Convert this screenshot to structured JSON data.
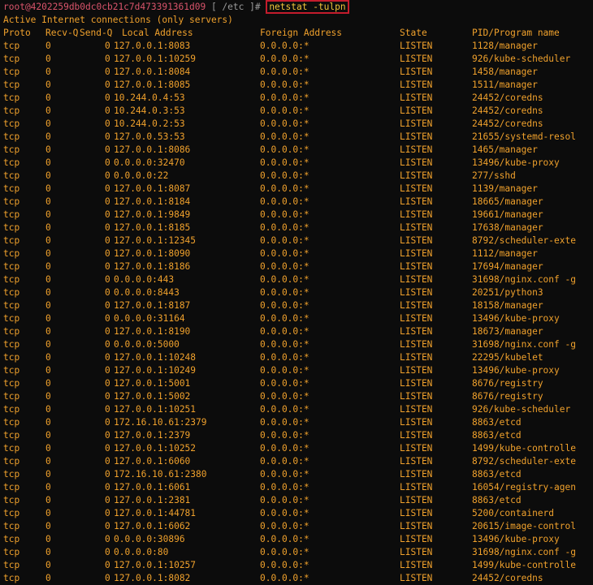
{
  "prompt": {
    "user_host": "root@4202259db0dc0cb21c7d473391361d09",
    "path": " [ /etc ]# ",
    "command": "netstat -tulpn"
  },
  "info_line": "Active Internet connections (only servers)",
  "headers": {
    "proto": "Proto",
    "recv": "Recv-Q",
    "send": "Send-Q",
    "local": "Local Address",
    "foreign": "Foreign Address",
    "state": "State",
    "pid": "PID/Program name"
  },
  "rows": [
    {
      "proto": "tcp",
      "recv": "0",
      "send": "0",
      "local": "127.0.0.1:8083",
      "foreign": "0.0.0.0:*",
      "state": "LISTEN",
      "pid": "1128/manager"
    },
    {
      "proto": "tcp",
      "recv": "0",
      "send": "0",
      "local": "127.0.0.1:10259",
      "foreign": "0.0.0.0:*",
      "state": "LISTEN",
      "pid": "926/kube-scheduler"
    },
    {
      "proto": "tcp",
      "recv": "0",
      "send": "0",
      "local": "127.0.0.1:8084",
      "foreign": "0.0.0.0:*",
      "state": "LISTEN",
      "pid": "1458/manager"
    },
    {
      "proto": "tcp",
      "recv": "0",
      "send": "0",
      "local": "127.0.0.1:8085",
      "foreign": "0.0.0.0:*",
      "state": "LISTEN",
      "pid": "1511/manager"
    },
    {
      "proto": "tcp",
      "recv": "0",
      "send": "0",
      "local": "10.244.0.4:53",
      "foreign": "0.0.0.0:*",
      "state": "LISTEN",
      "pid": "24452/coredns"
    },
    {
      "proto": "tcp",
      "recv": "0",
      "send": "0",
      "local": "10.244.0.3:53",
      "foreign": "0.0.0.0:*",
      "state": "LISTEN",
      "pid": "24452/coredns"
    },
    {
      "proto": "tcp",
      "recv": "0",
      "send": "0",
      "local": "10.244.0.2:53",
      "foreign": "0.0.0.0:*",
      "state": "LISTEN",
      "pid": "24452/coredns"
    },
    {
      "proto": "tcp",
      "recv": "0",
      "send": "0",
      "local": "127.0.0.53:53",
      "foreign": "0.0.0.0:*",
      "state": "LISTEN",
      "pid": "21655/systemd-resol"
    },
    {
      "proto": "tcp",
      "recv": "0",
      "send": "0",
      "local": "127.0.0.1:8086",
      "foreign": "0.0.0.0:*",
      "state": "LISTEN",
      "pid": "1465/manager"
    },
    {
      "proto": "tcp",
      "recv": "0",
      "send": "0",
      "local": "0.0.0.0:32470",
      "foreign": "0.0.0.0:*",
      "state": "LISTEN",
      "pid": "13496/kube-proxy"
    },
    {
      "proto": "tcp",
      "recv": "0",
      "send": "0",
      "local": "0.0.0.0:22",
      "foreign": "0.0.0.0:*",
      "state": "LISTEN",
      "pid": "277/sshd"
    },
    {
      "proto": "tcp",
      "recv": "0",
      "send": "0",
      "local": "127.0.0.1:8087",
      "foreign": "0.0.0.0:*",
      "state": "LISTEN",
      "pid": "1139/manager"
    },
    {
      "proto": "tcp",
      "recv": "0",
      "send": "0",
      "local": "127.0.0.1:8184",
      "foreign": "0.0.0.0:*",
      "state": "LISTEN",
      "pid": "18665/manager"
    },
    {
      "proto": "tcp",
      "recv": "0",
      "send": "0",
      "local": "127.0.0.1:9849",
      "foreign": "0.0.0.0:*",
      "state": "LISTEN",
      "pid": "19661/manager"
    },
    {
      "proto": "tcp",
      "recv": "0",
      "send": "0",
      "local": "127.0.0.1:8185",
      "foreign": "0.0.0.0:*",
      "state": "LISTEN",
      "pid": "17638/manager"
    },
    {
      "proto": "tcp",
      "recv": "0",
      "send": "0",
      "local": "127.0.0.1:12345",
      "foreign": "0.0.0.0:*",
      "state": "LISTEN",
      "pid": "8792/scheduler-exte"
    },
    {
      "proto": "tcp",
      "recv": "0",
      "send": "0",
      "local": "127.0.0.1:8090",
      "foreign": "0.0.0.0:*",
      "state": "LISTEN",
      "pid": "1112/manager"
    },
    {
      "proto": "tcp",
      "recv": "0",
      "send": "0",
      "local": "127.0.0.1:8186",
      "foreign": "0.0.0.0:*",
      "state": "LISTEN",
      "pid": "17694/manager"
    },
    {
      "proto": "tcp",
      "recv": "0",
      "send": "0",
      "local": "0.0.0.0:443",
      "foreign": "0.0.0.0:*",
      "state": "LISTEN",
      "pid": "31698/nginx.conf -g"
    },
    {
      "proto": "tcp",
      "recv": "0",
      "send": "0",
      "local": "0.0.0.0:8443",
      "foreign": "0.0.0.0:*",
      "state": "LISTEN",
      "pid": "20251/python3"
    },
    {
      "proto": "tcp",
      "recv": "0",
      "send": "0",
      "local": "127.0.0.1:8187",
      "foreign": "0.0.0.0:*",
      "state": "LISTEN",
      "pid": "18158/manager"
    },
    {
      "proto": "tcp",
      "recv": "0",
      "send": "0",
      "local": "0.0.0.0:31164",
      "foreign": "0.0.0.0:*",
      "state": "LISTEN",
      "pid": "13496/kube-proxy"
    },
    {
      "proto": "tcp",
      "recv": "0",
      "send": "0",
      "local": "127.0.0.1:8190",
      "foreign": "0.0.0.0:*",
      "state": "LISTEN",
      "pid": "18673/manager"
    },
    {
      "proto": "tcp",
      "recv": "0",
      "send": "0",
      "local": "0.0.0.0:5000",
      "foreign": "0.0.0.0:*",
      "state": "LISTEN",
      "pid": "31698/nginx.conf -g"
    },
    {
      "proto": "tcp",
      "recv": "0",
      "send": "0",
      "local": "127.0.0.1:10248",
      "foreign": "0.0.0.0:*",
      "state": "LISTEN",
      "pid": "22295/kubelet"
    },
    {
      "proto": "tcp",
      "recv": "0",
      "send": "0",
      "local": "127.0.0.1:10249",
      "foreign": "0.0.0.0:*",
      "state": "LISTEN",
      "pid": "13496/kube-proxy"
    },
    {
      "proto": "tcp",
      "recv": "0",
      "send": "0",
      "local": "127.0.0.1:5001",
      "foreign": "0.0.0.0:*",
      "state": "LISTEN",
      "pid": "8676/registry"
    },
    {
      "proto": "tcp",
      "recv": "0",
      "send": "0",
      "local": "127.0.0.1:5002",
      "foreign": "0.0.0.0:*",
      "state": "LISTEN",
      "pid": "8676/registry"
    },
    {
      "proto": "tcp",
      "recv": "0",
      "send": "0",
      "local": "127.0.0.1:10251",
      "foreign": "0.0.0.0:*",
      "state": "LISTEN",
      "pid": "926/kube-scheduler"
    },
    {
      "proto": "tcp",
      "recv": "0",
      "send": "0",
      "local": "172.16.10.61:2379",
      "foreign": "0.0.0.0:*",
      "state": "LISTEN",
      "pid": "8863/etcd"
    },
    {
      "proto": "tcp",
      "recv": "0",
      "send": "0",
      "local": "127.0.0.1:2379",
      "foreign": "0.0.0.0:*",
      "state": "LISTEN",
      "pid": "8863/etcd"
    },
    {
      "proto": "tcp",
      "recv": "0",
      "send": "0",
      "local": "127.0.0.1:10252",
      "foreign": "0.0.0.0:*",
      "state": "LISTEN",
      "pid": "1499/kube-controlle"
    },
    {
      "proto": "tcp",
      "recv": "0",
      "send": "0",
      "local": "127.0.0.1:6060",
      "foreign": "0.0.0.0:*",
      "state": "LISTEN",
      "pid": "8792/scheduler-exte"
    },
    {
      "proto": "tcp",
      "recv": "0",
      "send": "0",
      "local": "172.16.10.61:2380",
      "foreign": "0.0.0.0:*",
      "state": "LISTEN",
      "pid": "8863/etcd"
    },
    {
      "proto": "tcp",
      "recv": "0",
      "send": "0",
      "local": "127.0.0.1:6061",
      "foreign": "0.0.0.0:*",
      "state": "LISTEN",
      "pid": "16054/registry-agen"
    },
    {
      "proto": "tcp",
      "recv": "0",
      "send": "0",
      "local": "127.0.0.1:2381",
      "foreign": "0.0.0.0:*",
      "state": "LISTEN",
      "pid": "8863/etcd"
    },
    {
      "proto": "tcp",
      "recv": "0",
      "send": "0",
      "local": "127.0.0.1:44781",
      "foreign": "0.0.0.0:*",
      "state": "LISTEN",
      "pid": "5200/containerd"
    },
    {
      "proto": "tcp",
      "recv": "0",
      "send": "0",
      "local": "127.0.0.1:6062",
      "foreign": "0.0.0.0:*",
      "state": "LISTEN",
      "pid": "20615/image-control"
    },
    {
      "proto": "tcp",
      "recv": "0",
      "send": "0",
      "local": "0.0.0.0:30896",
      "foreign": "0.0.0.0:*",
      "state": "LISTEN",
      "pid": "13496/kube-proxy"
    },
    {
      "proto": "tcp",
      "recv": "0",
      "send": "0",
      "local": "0.0.0.0:80",
      "foreign": "0.0.0.0:*",
      "state": "LISTEN",
      "pid": "31698/nginx.conf -g"
    },
    {
      "proto": "tcp",
      "recv": "0",
      "send": "0",
      "local": "127.0.0.1:10257",
      "foreign": "0.0.0.0:*",
      "state": "LISTEN",
      "pid": "1499/kube-controlle"
    },
    {
      "proto": "tcp",
      "recv": "0",
      "send": "0",
      "local": "127.0.0.1:8082",
      "foreign": "0.0.0.0:*",
      "state": "LISTEN",
      "pid": "24452/coredns"
    }
  ]
}
